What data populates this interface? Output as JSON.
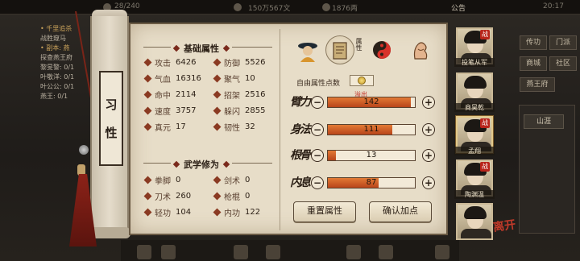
{
  "colors": {
    "panel_bg": "#e7ddc8",
    "bar_fill": "#d1652a",
    "accent_red": "#b8241a",
    "text_dark": "#2a1e14"
  },
  "topbar": {
    "resource1": "28/240",
    "resource2": "150万567文",
    "resource3": "1876两",
    "notice": "公告",
    "time": "20:17"
  },
  "left_quests": [
    {
      "text": "• 千里追杀",
      "hl": true
    },
    {
      "text": "战胜窥马",
      "hl": false
    },
    {
      "text": "• 副本: 燕",
      "hl": true
    },
    {
      "text": "探查燕王府",
      "hl": false
    },
    {
      "text": "黎旻警: 0/1",
      "hl": false
    },
    {
      "text": "叶敬洋: 0/1",
      "hl": false
    },
    {
      "text": "叶公公: 0/1",
      "hl": false
    },
    {
      "text": "燕王: 0/1",
      "hl": false
    }
  ],
  "right_menu": {
    "btn1": "传功",
    "btn2": "门派",
    "btn3": "商城",
    "btn4": "社区",
    "btn5": "燕王府",
    "location": "山涯"
  },
  "scroll": {
    "nature_char1": "习",
    "nature_char2": "性"
  },
  "basic": {
    "title": "基础属性",
    "stats": [
      {
        "label": "攻击",
        "value": "6426"
      },
      {
        "label": "防御",
        "value": "5526"
      },
      {
        "label": "气血",
        "value": "16316"
      },
      {
        "label": "聚气",
        "value": "10"
      },
      {
        "label": "命中",
        "value": "2114"
      },
      {
        "label": "招架",
        "value": "2516"
      },
      {
        "label": "速度",
        "value": "3757"
      },
      {
        "label": "躲闪",
        "value": "2855"
      },
      {
        "label": "真元",
        "value": "17"
      },
      {
        "label": "韧性",
        "value": "32"
      }
    ]
  },
  "martial": {
    "title": "武学修为",
    "stats": [
      {
        "label": "拳脚",
        "value": "0"
      },
      {
        "label": "剑术",
        "value": "0"
      },
      {
        "label": "刀术",
        "value": "260"
      },
      {
        "label": "枪棍",
        "value": "0"
      },
      {
        "label": "轻功",
        "value": "104"
      },
      {
        "label": "内功",
        "value": "122"
      }
    ]
  },
  "tabs": {
    "active_label": "属性"
  },
  "allocation": {
    "free_points_label": "自由属性点数",
    "free_points_value": "0",
    "overflow_label": "溢出",
    "attributes": [
      {
        "calligraphy": "臂力",
        "value": "142",
        "fill_pct": 95
      },
      {
        "calligraphy": "身法",
        "value": "111",
        "fill_pct": 74
      },
      {
        "calligraphy": "根骨",
        "value": "13",
        "fill_pct": 9
      },
      {
        "calligraphy": "内息",
        "value": "87",
        "fill_pct": 58
      }
    ],
    "reset_button": "重置属性",
    "confirm_button": "确认加点"
  },
  "party": [
    {
      "name": "投笔从军",
      "war": "战"
    },
    {
      "name": "商昊乾",
      "war": ""
    },
    {
      "name": "孟翔",
      "war": "战"
    },
    {
      "name": "陶渊温",
      "war": "战"
    },
    {
      "name": "",
      "war": ""
    }
  ],
  "corner_logo": "离开"
}
